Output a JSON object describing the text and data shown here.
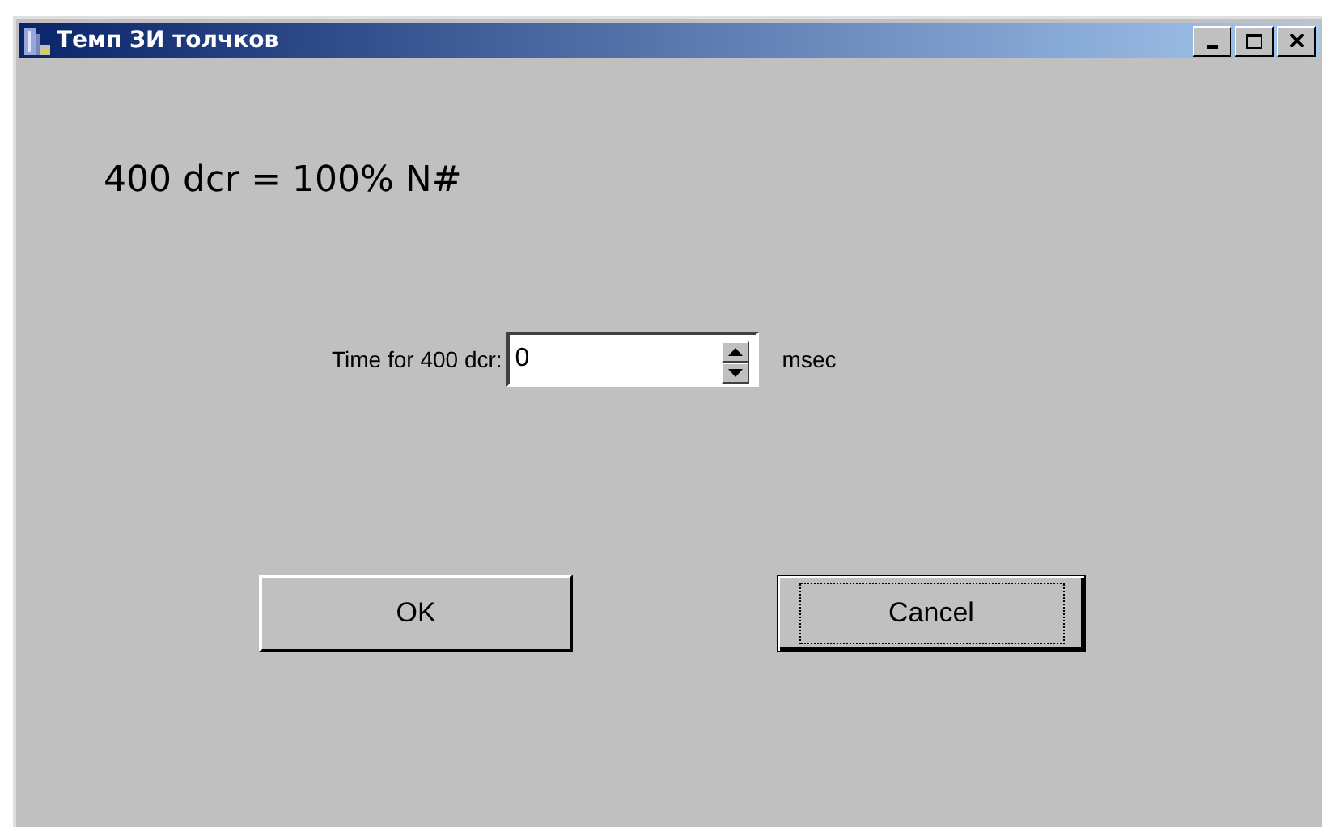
{
  "window": {
    "title": "Темп ЗИ толчков",
    "controls": [
      {
        "kind": "minimize"
      },
      {
        "kind": "maximize"
      },
      {
        "kind": "close"
      }
    ]
  },
  "heading": "400 dcr = 100% N#",
  "time_field": {
    "label": "Time for 400 dcr:",
    "value": "0",
    "unit": "msec"
  },
  "buttons": [
    {
      "label": "OK",
      "focused": false
    },
    {
      "label": "Cancel",
      "focused": true
    }
  ]
}
